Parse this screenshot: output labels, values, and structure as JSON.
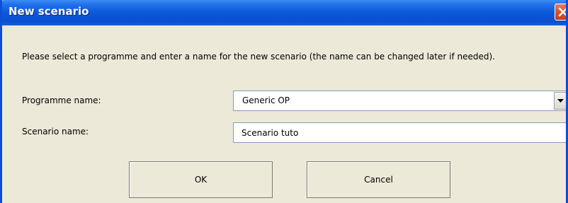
{
  "window": {
    "title": "New scenario",
    "close_icon": "close-icon"
  },
  "instruction": "Please select a programme and enter a name for the new scenario (the name can be changed later if needed).",
  "form": {
    "programme_label": "Programme name:",
    "programme_value": "Generic OP",
    "scenario_label": "Scenario name:",
    "scenario_value": "Scenario tuto"
  },
  "buttons": {
    "ok_label": "OK",
    "cancel_label": "Cancel"
  },
  "colors": {
    "titlebar": "#0a56d8",
    "close_button": "#d8532c",
    "background": "#ece9d8"
  }
}
